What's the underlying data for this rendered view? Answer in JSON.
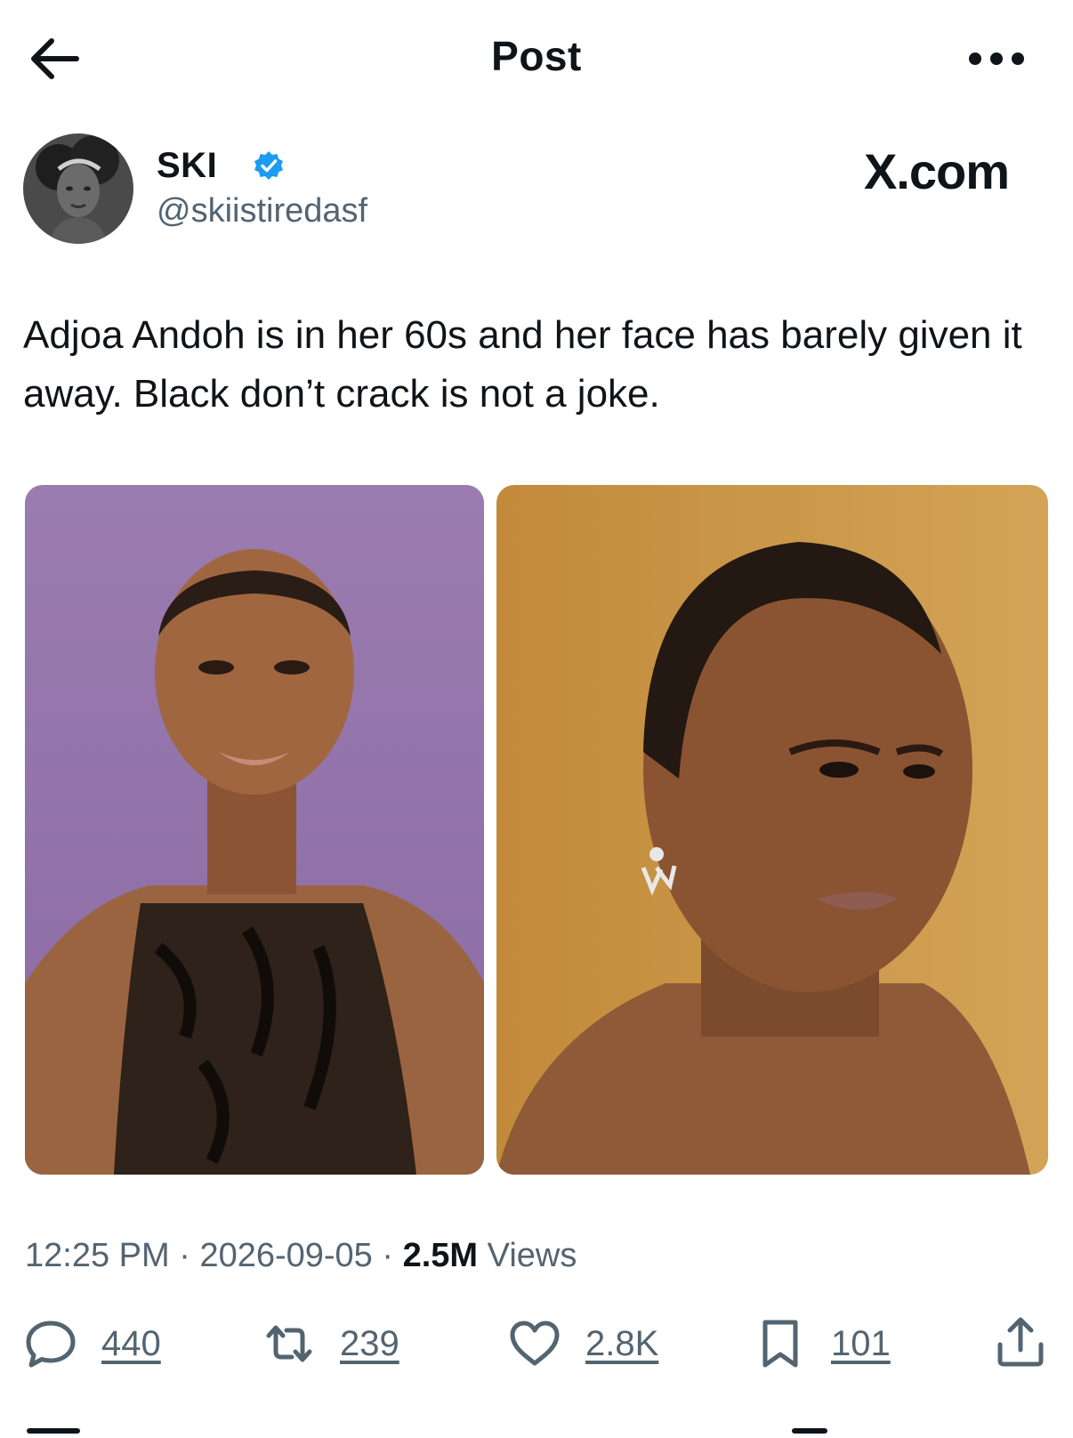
{
  "header": {
    "title": "Post"
  },
  "author": {
    "display_name": "SKI",
    "handle": "@skiistiredasf",
    "site_mark": "X.com"
  },
  "post": {
    "text": "Adjoa Andoh is in her 60s and her face has barely given it away. Black don’t crack is not a joke.",
    "time": "12:25 PM",
    "date": "2026-09-05",
    "separator": "·",
    "views_count": "2.5M",
    "views_label": "Views"
  },
  "actions": {
    "replies": "440",
    "reposts": "239",
    "likes": "2.8K",
    "bookmarks": "101"
  },
  "icons": {
    "back": "back-arrow-icon",
    "more": "more-dots-icon",
    "verified": "verified-badge-icon",
    "reply": "reply-bubble-icon",
    "repost": "repost-arrows-icon",
    "like": "heart-icon",
    "bookmark": "bookmark-icon",
    "share": "share-icon"
  },
  "colors": {
    "text": "#0f1419",
    "secondary": "#536471",
    "verified": "#1d9bf0",
    "background": "#ffffff"
  }
}
